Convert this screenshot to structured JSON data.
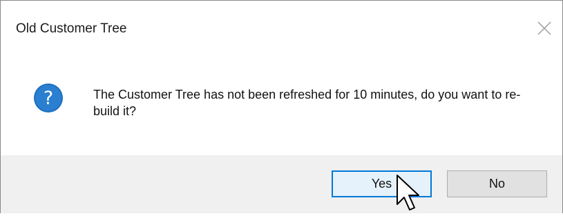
{
  "dialog": {
    "title": "Old Customer Tree",
    "message": "The Customer Tree has not been refreshed for 10 minutes, do you want to re-build it?",
    "icon": "question-icon",
    "accent_color": "#0078d7",
    "buttons": {
      "yes_label": "Yes",
      "no_label": "No"
    }
  }
}
